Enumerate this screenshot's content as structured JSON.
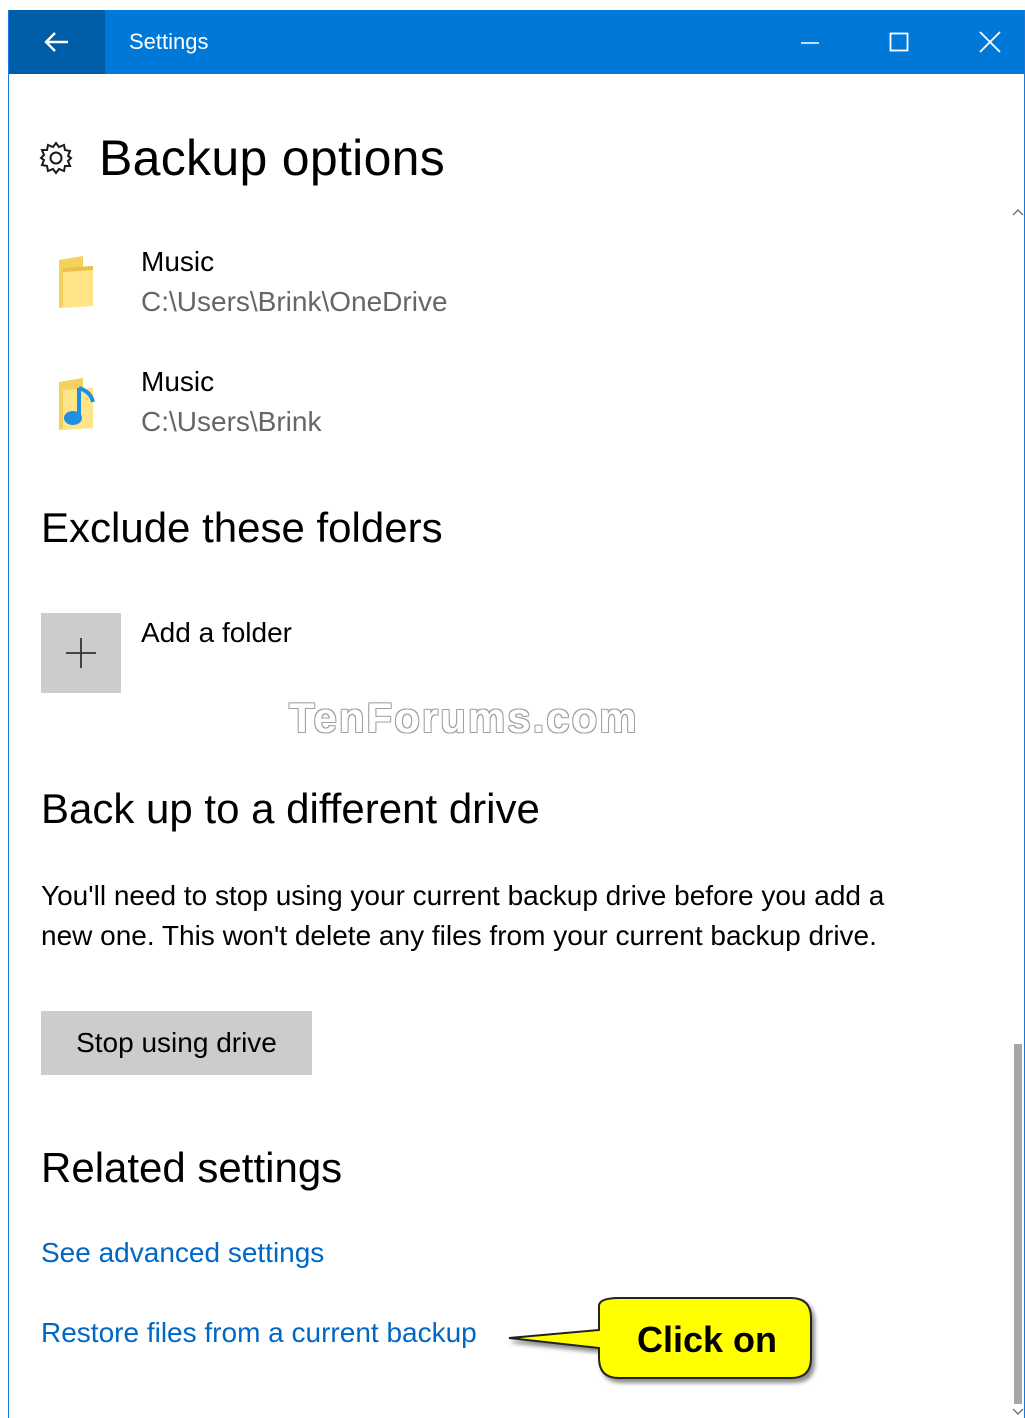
{
  "window": {
    "title": "Settings",
    "back_icon": "arrow-left-icon",
    "minimize_icon": "minimize-icon",
    "maximize_icon": "maximize-icon",
    "close_icon": "close-icon"
  },
  "page": {
    "title": "Backup options",
    "title_icon": "gear-icon"
  },
  "included_folders": [
    {
      "name": "Music",
      "path": "C:\\Users\\Brink\\OneDrive",
      "icon": "folder-icon"
    },
    {
      "name": "Music",
      "path": "C:\\Users\\Brink",
      "icon": "music-folder-icon"
    }
  ],
  "exclude": {
    "heading": "Exclude these folders",
    "add_label": "Add a folder",
    "add_icon": "plus-icon"
  },
  "watermark": "TenForums.com",
  "different_drive": {
    "heading": "Back up to a different drive",
    "description": "You'll need to stop using your current backup drive before you add a new one. This won't delete any files from your current backup drive.",
    "stop_button": "Stop using drive"
  },
  "related": {
    "heading": "Related settings",
    "links": [
      "See advanced settings",
      "Restore files from a current backup"
    ]
  },
  "callout": {
    "text": "Click on"
  },
  "colors": {
    "titlebar": "#0078d7",
    "back_button": "#005da8",
    "link": "#0067c5",
    "button_bg": "#cccccc",
    "callout_fill": "#ffff00"
  }
}
